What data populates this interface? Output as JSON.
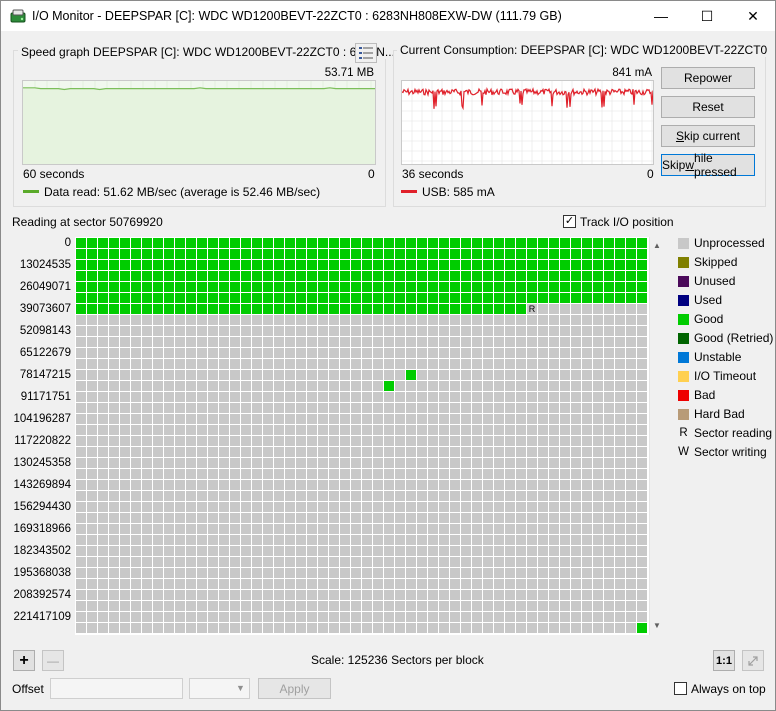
{
  "window": {
    "title": "I/O Monitor - DEEPSPAR [C]: WDC WD1200BEVT-22ZCT0 : 6283NH808EXW-DW (111.79 GB)",
    "minimize": "—",
    "maximize": "☐",
    "close": "✕"
  },
  "speed_graph": {
    "group_title": "Speed graph DEEPSPAR [C]: WDC WD1200BEVT-22ZCT0 : 6283N...",
    "max_value": "53.71 MB",
    "x_left": "60 seconds",
    "x_right": "0",
    "legend": "Data read:  51.62 MB/sec (average is 52.46 MB/sec)",
    "line_color": "#7cbf5a",
    "legend_color": "#5aaa2a",
    "values": [
      92,
      92,
      92,
      91,
      91,
      91,
      91,
      90,
      91,
      91,
      91,
      91,
      91,
      90,
      91,
      91,
      91,
      91,
      91,
      91,
      91,
      91,
      91,
      91,
      91,
      91,
      91,
      91,
      91,
      91,
      92,
      91,
      91,
      91,
      91,
      91,
      91,
      91,
      91,
      91,
      91,
      91,
      91,
      91,
      91,
      91,
      91,
      91,
      91,
      91,
      91,
      91,
      92,
      91,
      91,
      91,
      91,
      91,
      91,
      91,
      91
    ],
    "options_icon": "graph-options-icon"
  },
  "consumption": {
    "group_title": "Current Consumption: DEEPSPAR [C]: WDC WD1200BEVT-22ZCT0",
    "max_value": "841 mA",
    "x_left": "36 seconds",
    "x_right": "0",
    "legend": "USB:  585 mA",
    "line_color": "#e0202a"
  },
  "buttons": {
    "repower": "Repower",
    "reset": "Reset",
    "skip_current_pre": "",
    "skip_current_u": "S",
    "skip_current_post": "kip current",
    "skip_while_pre": "Skip ",
    "skip_while_u": "w",
    "skip_while_post": "hile pressed"
  },
  "status": {
    "reading_at": "Reading at sector 50769920",
    "track_io": "Track I/O position",
    "track_io_checked": "✓"
  },
  "sector_offsets": [
    "0",
    "13024535",
    "26049071",
    "39073607",
    "52098143",
    "65122679",
    "78147215",
    "91171751",
    "104196287",
    "117220822",
    "130245358",
    "143269894",
    "156294430",
    "169318966",
    "182343502",
    "195368038",
    "208392574",
    "221417109"
  ],
  "grid": {
    "cols": 52,
    "rows": 36,
    "full_good_rows": 7,
    "partial_good_row_cols": 41,
    "reading_marker": "R",
    "extra_good_cells": [
      [
        30,
        12
      ],
      [
        28,
        13
      ],
      [
        51,
        35
      ]
    ],
    "colors": {
      "unprocessed": "#c8c8c8",
      "good": "#00cc00"
    }
  },
  "legend": [
    {
      "label": "Unprocessed",
      "color": "#c8c8c8"
    },
    {
      "label": "Skipped",
      "color": "#808000"
    },
    {
      "label": "Unused",
      "color": "#4b0a5a"
    },
    {
      "label": "Used",
      "color": "#000080"
    },
    {
      "label": "Good",
      "color": "#00cc00"
    },
    {
      "label": "Good (Retried)",
      "color": "#006400"
    },
    {
      "label": "Unstable",
      "color": "#0078d7"
    },
    {
      "label": "I/O Timeout",
      "color": "#ffd050"
    },
    {
      "label": "Bad",
      "color": "#ee0000"
    },
    {
      "label": "Hard Bad",
      "color": "#b89b78"
    }
  ],
  "legend_chars": [
    {
      "char": "R",
      "label": "Sector reading"
    },
    {
      "char": "W",
      "label": "Sector writing"
    }
  ],
  "bottom": {
    "zoom_in": "+",
    "zoom_out": "—",
    "scale": "Scale:  125236 Sectors per block",
    "ratio": "1:1",
    "offset_label": "Offset",
    "offset_value": "",
    "apply": "Apply",
    "always_on_top": "Always on top"
  }
}
